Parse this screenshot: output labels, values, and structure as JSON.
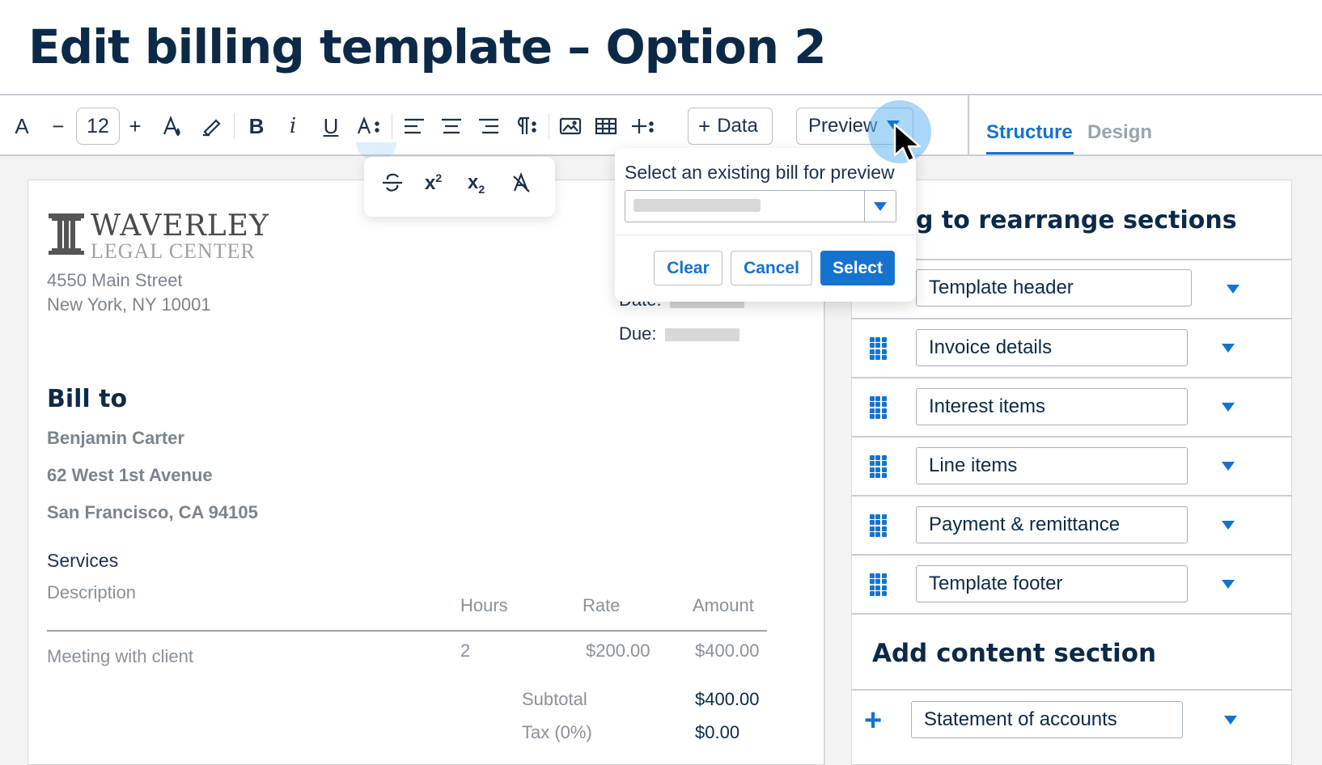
{
  "page": {
    "title": "Edit billing template – Option 2"
  },
  "toolbar": {
    "font_a": "A",
    "minus": "−",
    "font_size": "12",
    "plus": "+",
    "bold": "B",
    "italic": "i",
    "underline": "U",
    "add_data_label": "Data",
    "preview_label": "Preview"
  },
  "tabs": {
    "structure": "Structure",
    "design": "Design"
  },
  "float_toolbar": {
    "icons": [
      "strikethrough-icon",
      "superscript-icon",
      "subscript-icon",
      "clear-format-icon"
    ],
    "superscript_label": "x",
    "subscript_label": "x"
  },
  "document": {
    "logo_name": "WAVERLEY",
    "logo_sub": "LEGAL CENTER",
    "address_line1": "4550 Main Street",
    "address_line2": "New York, NY 10001",
    "date_label": "Date:",
    "due_label": "Due:",
    "bill_to_heading": "Bill to",
    "customer_name": "Benjamin Carter",
    "customer_street": "62 West 1st Avenue",
    "customer_city": "San Francisco, CA 94105",
    "services_heading": "Services",
    "columns": {
      "description": "Description",
      "hours": "Hours",
      "rate": "Rate",
      "amount": "Amount"
    },
    "line_item": {
      "description": "Meeting with client",
      "hours": "2",
      "rate": "$200.00",
      "amount": "$400.00"
    },
    "subtotal_label": "Subtotal",
    "subtotal_value": "$400.00",
    "tax_label": "Tax (0%)",
    "tax_value": "$0.00"
  },
  "structure": {
    "heading": "g to rearrange sections",
    "sections": [
      {
        "label": "Template header"
      },
      {
        "label": "Invoice details"
      },
      {
        "label": "Interest items"
      },
      {
        "label": "Line items"
      },
      {
        "label": "Payment & remittance"
      },
      {
        "label": "Template footer"
      }
    ],
    "add_heading": "Add content section",
    "add_option": "Statement of accounts"
  },
  "preview_popup": {
    "title": "Select an existing bill for preview",
    "clear_label": "Clear",
    "cancel_label": "Cancel",
    "select_label": "Select"
  },
  "colors": {
    "accent": "#1573d0",
    "heading": "#0c2a47",
    "muted": "#7b848d"
  }
}
